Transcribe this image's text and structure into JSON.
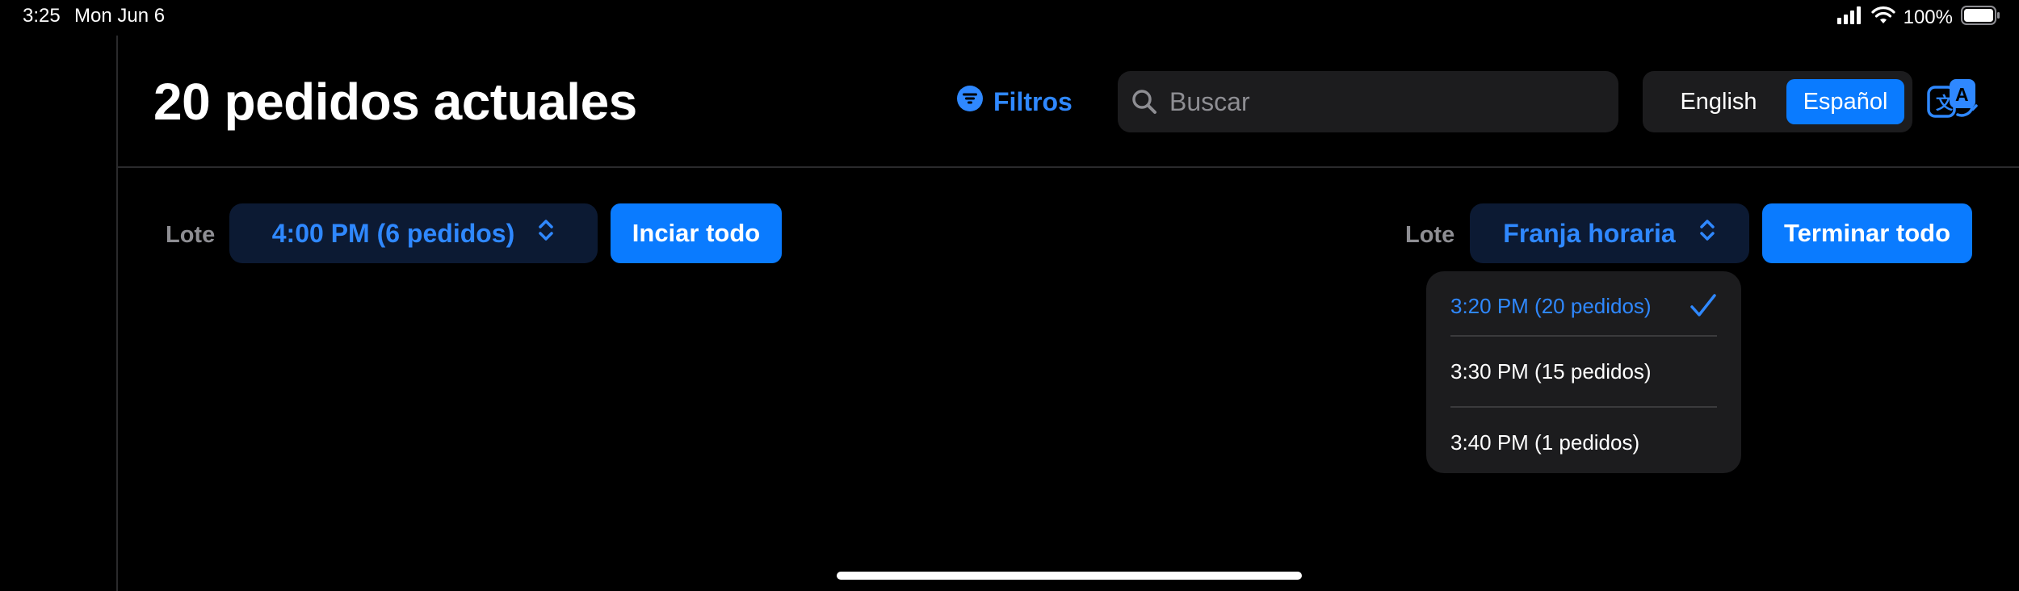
{
  "status_bar": {
    "time": "3:25",
    "date": "Mon Jun 6",
    "battery": "100%"
  },
  "header": {
    "title": "20 pedidos actuales",
    "filter_label": "Filtros",
    "search_placeholder": "Buscar",
    "language_options": [
      "English",
      "Español"
    ],
    "selected_language": "Español"
  },
  "toolbar": {
    "lote_label": "Lote",
    "batch_value": "4:00 PM (6 pedidos)",
    "start_all_label": "Inciar todo",
    "slot_value": "Franja horaria",
    "finish_all_label": "Terminar todo"
  },
  "dropdown": {
    "items": [
      "3:20 PM (20 pedidos)",
      "3:30 PM (15 pedidos)",
      "3:40 PM (1 pedidos)"
    ],
    "selected": "3:20 PM (20 pedidos)"
  },
  "colors": {
    "accent": "#0a7bff",
    "link": "#2f88ff",
    "background": "#000000",
    "surface": "#1c1c1e",
    "secondary_text": "#8e8e93"
  },
  "icons": [
    "cellular-signal-icon",
    "wifi-icon",
    "battery-icon",
    "filter-icon",
    "search-icon",
    "translate-icon",
    "chevron-up-down-icon",
    "checkmark-icon"
  ]
}
